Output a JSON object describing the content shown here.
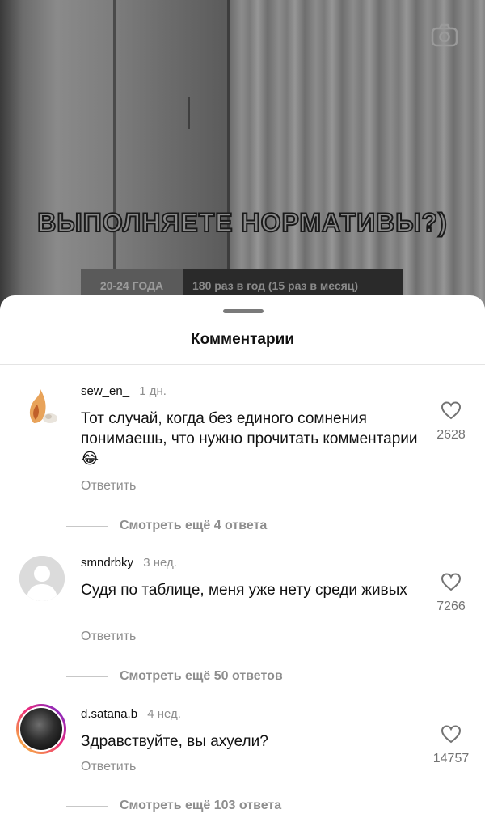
{
  "video": {
    "overlay_title": "ВЫПОЛНЯЕТЕ НОРМАТИВЫ?)",
    "table_row": {
      "age": "20-24 ГОДА",
      "norm": "180 раз в год (15 раз в месяц)"
    },
    "camera_icon": "camera-icon"
  },
  "sheet": {
    "title": "Комментарии"
  },
  "comments": [
    {
      "username": "sew_en_",
      "time": "1 дн.",
      "text": "Тот случай, когда без единого сомнения понимаешь, что нужно прочитать комментарии😂",
      "reply_label": "Ответить",
      "likes": "2628",
      "more_replies": "Смотреть ещё 4 ответа"
    },
    {
      "username": "smndrbky",
      "time": "3 нед.",
      "text": "Судя по таблице, меня уже нету среди живых",
      "reply_label": "Ответить",
      "likes": "7266",
      "more_replies": "Смотреть ещё 50 ответов"
    },
    {
      "username": "d.satana.b",
      "time": "4 нед.",
      "text": "Здравствуйте, вы ахуели?",
      "reply_label": "Ответить",
      "likes": "14757",
      "more_replies": "Смотреть ещё 103 ответа"
    }
  ]
}
